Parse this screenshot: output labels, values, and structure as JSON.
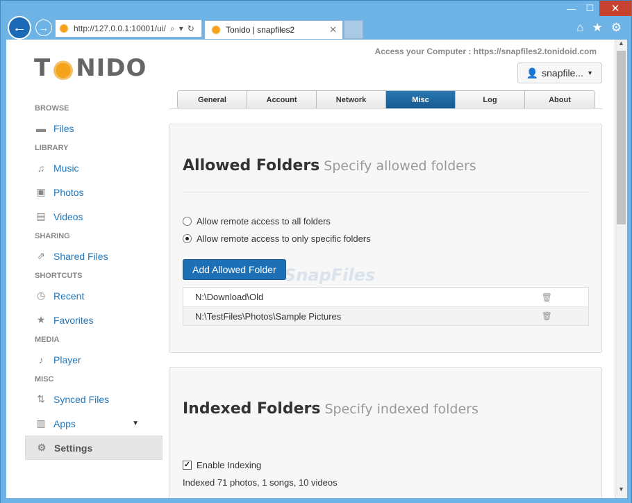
{
  "browser": {
    "url": "http://127.0.0.1:10001/ui/",
    "tab_title": "Tonido | snapfiles2",
    "tab_close": "✕"
  },
  "header": {
    "logo_text_1": "T",
    "logo_text_2": "NIDO",
    "access_text": "Access your Computer : https://snapfiles2.tonidoid.com",
    "user_label": "snapfile..."
  },
  "sidebar": {
    "sections": [
      {
        "heading": "BROWSE",
        "items": [
          {
            "label": "Files",
            "icon": "folder-icon"
          }
        ]
      },
      {
        "heading": "LIBRARY",
        "items": [
          {
            "label": "Music",
            "icon": "music-icon"
          },
          {
            "label": "Photos",
            "icon": "photo-icon"
          },
          {
            "label": "Videos",
            "icon": "film-icon"
          }
        ]
      },
      {
        "heading": "SHARING",
        "items": [
          {
            "label": "Shared Files",
            "icon": "share-icon"
          }
        ]
      },
      {
        "heading": "SHORTCUTS",
        "items": [
          {
            "label": "Recent",
            "icon": "clock-icon"
          },
          {
            "label": "Favorites",
            "icon": "star-icon"
          }
        ]
      },
      {
        "heading": "MEDIA",
        "items": [
          {
            "label": "Player",
            "icon": "music-icon"
          }
        ]
      },
      {
        "heading": "MISC",
        "items": [
          {
            "label": "Synced Files",
            "icon": "sync-icon"
          },
          {
            "label": "Apps",
            "icon": "apps-icon"
          }
        ]
      }
    ],
    "settings_label": "Settings"
  },
  "tabs": [
    {
      "label": "General"
    },
    {
      "label": "Account"
    },
    {
      "label": "Network"
    },
    {
      "label": "Misc",
      "active": true
    },
    {
      "label": "Log"
    },
    {
      "label": "About"
    }
  ],
  "allowed": {
    "title": "Allowed Folders",
    "subtitle": "Specify allowed folders",
    "option_all": "Allow remote access to all folders",
    "option_specific": "Allow remote access to only specific folders",
    "selected": "specific",
    "add_button": "Add Allowed Folder",
    "folders": [
      "N:\\Download\\Old",
      "N:\\TestFiles\\Photos\\Sample Pictures"
    ]
  },
  "indexed": {
    "title": "Indexed Folders",
    "subtitle": "Specify indexed folders",
    "enable_label": "Enable Indexing",
    "enabled": true,
    "info": "Indexed 71 photos, 1 songs, 10 videos"
  },
  "watermark": "SnapFiles",
  "colors": {
    "accent": "#1d6fb6",
    "link": "#1e77bd",
    "chrome": "#6db3e6"
  }
}
